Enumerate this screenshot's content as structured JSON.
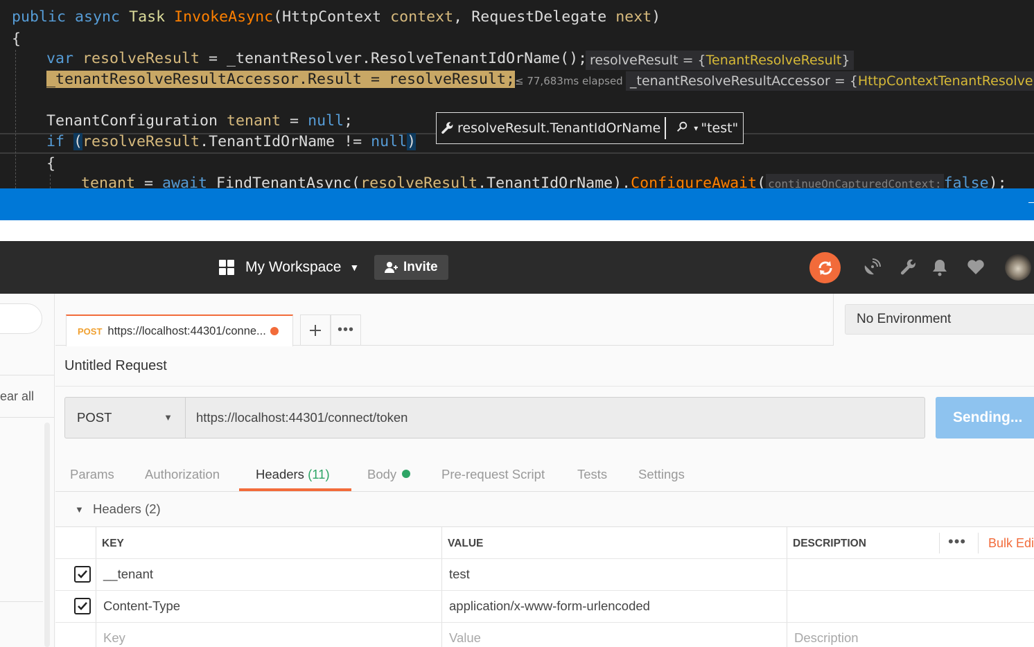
{
  "editor": {
    "line1": {
      "kw1": "public",
      "kw2": "async",
      "type": "Task",
      "method": "InvokeAsync",
      "open": "(",
      "ptype1": "HttpContext",
      "pname1": "context",
      "sep": ", ",
      "ptype2": "RequestDelegate",
      "pname2": "next",
      "close": ")"
    },
    "brace_open": "{",
    "line3": {
      "kw": "var",
      "local": "resolveResult",
      "rest": " = _tenantResolver.ResolveTenantIdOrName();"
    },
    "line4_code": "_tenantResolveResultAccessor.Result = resolveResult;",
    "line6": {
      "type": "TenantConfiguration",
      "local": "tenant",
      "eq": " = ",
      "null": "null",
      "semi": ";"
    },
    "line7": {
      "kw": "if",
      "paren_open": "(",
      "local": "resolveResult",
      "member": ".TenantIdOrName != ",
      "null": "null",
      "paren_close": ")"
    },
    "line8": "{",
    "line9": {
      "local": "tenant",
      "eq": " = ",
      "kw": "await",
      "call": " FindTenantAsync(",
      "arg_local": "resolveResult",
      "arg_member": ".TenantIdOrName).",
      "method": "ConfigureAwait",
      "paren": "(",
      "hint": "continueOnCapturedContext:",
      "val": "false",
      "end": ");"
    },
    "datatip1": {
      "name": "resolveResult = {",
      "value": "TenantResolveResult",
      "end": "}"
    },
    "elapsed": "≤ 77,683ms elapsed",
    "datatip2": {
      "name": "_tenantResolveResultAccessor = {",
      "value": "HttpContextTenantResolveRe"
    },
    "watch": {
      "expression": "resolveResult.TenantIdOrName",
      "value": "\"test\""
    }
  },
  "postman": {
    "workspace": "My Workspace",
    "invite": "Invite",
    "sidebar": {
      "clear_all": "ear all"
    },
    "tab": {
      "method": "POST",
      "url": "https://localhost:44301/conne..."
    },
    "environment": "No Environment",
    "request_title": "Untitled Request",
    "method": "POST",
    "url": "https://localhost:44301/connect/token",
    "send_label": "Sending...",
    "request_tabs": [
      {
        "label": "Params"
      },
      {
        "label": "Authorization"
      },
      {
        "label": "Headers",
        "count": "(11)"
      },
      {
        "label": "Body"
      },
      {
        "label": "Pre-request Script"
      },
      {
        "label": "Tests"
      },
      {
        "label": "Settings"
      }
    ],
    "headers_section": "Headers (2)",
    "table": {
      "key_header": "KEY",
      "value_header": "VALUE",
      "description_header": "DESCRIPTION",
      "bulk_edit": "Bulk Edi",
      "more": "•••",
      "rows": [
        {
          "key": "__tenant",
          "value": "test",
          "description": "",
          "checked": true
        },
        {
          "key": "Content-Type",
          "value": "application/x-www-form-urlencoded",
          "description": "",
          "checked": true
        }
      ],
      "placeholder": {
        "key": "Key",
        "value": "Value",
        "description": "Description"
      }
    },
    "colors": {
      "accent": "#f26b3a",
      "send_button": "#8ec3ef",
      "active_count": "#2ea566",
      "vs_blue": "#0078d7"
    },
    "icons": [
      "workspace-grid-icon",
      "add-user-icon",
      "sync-icon",
      "satellite-icon",
      "wrench-icon",
      "bell-icon",
      "heart-icon",
      "avatar"
    ]
  }
}
